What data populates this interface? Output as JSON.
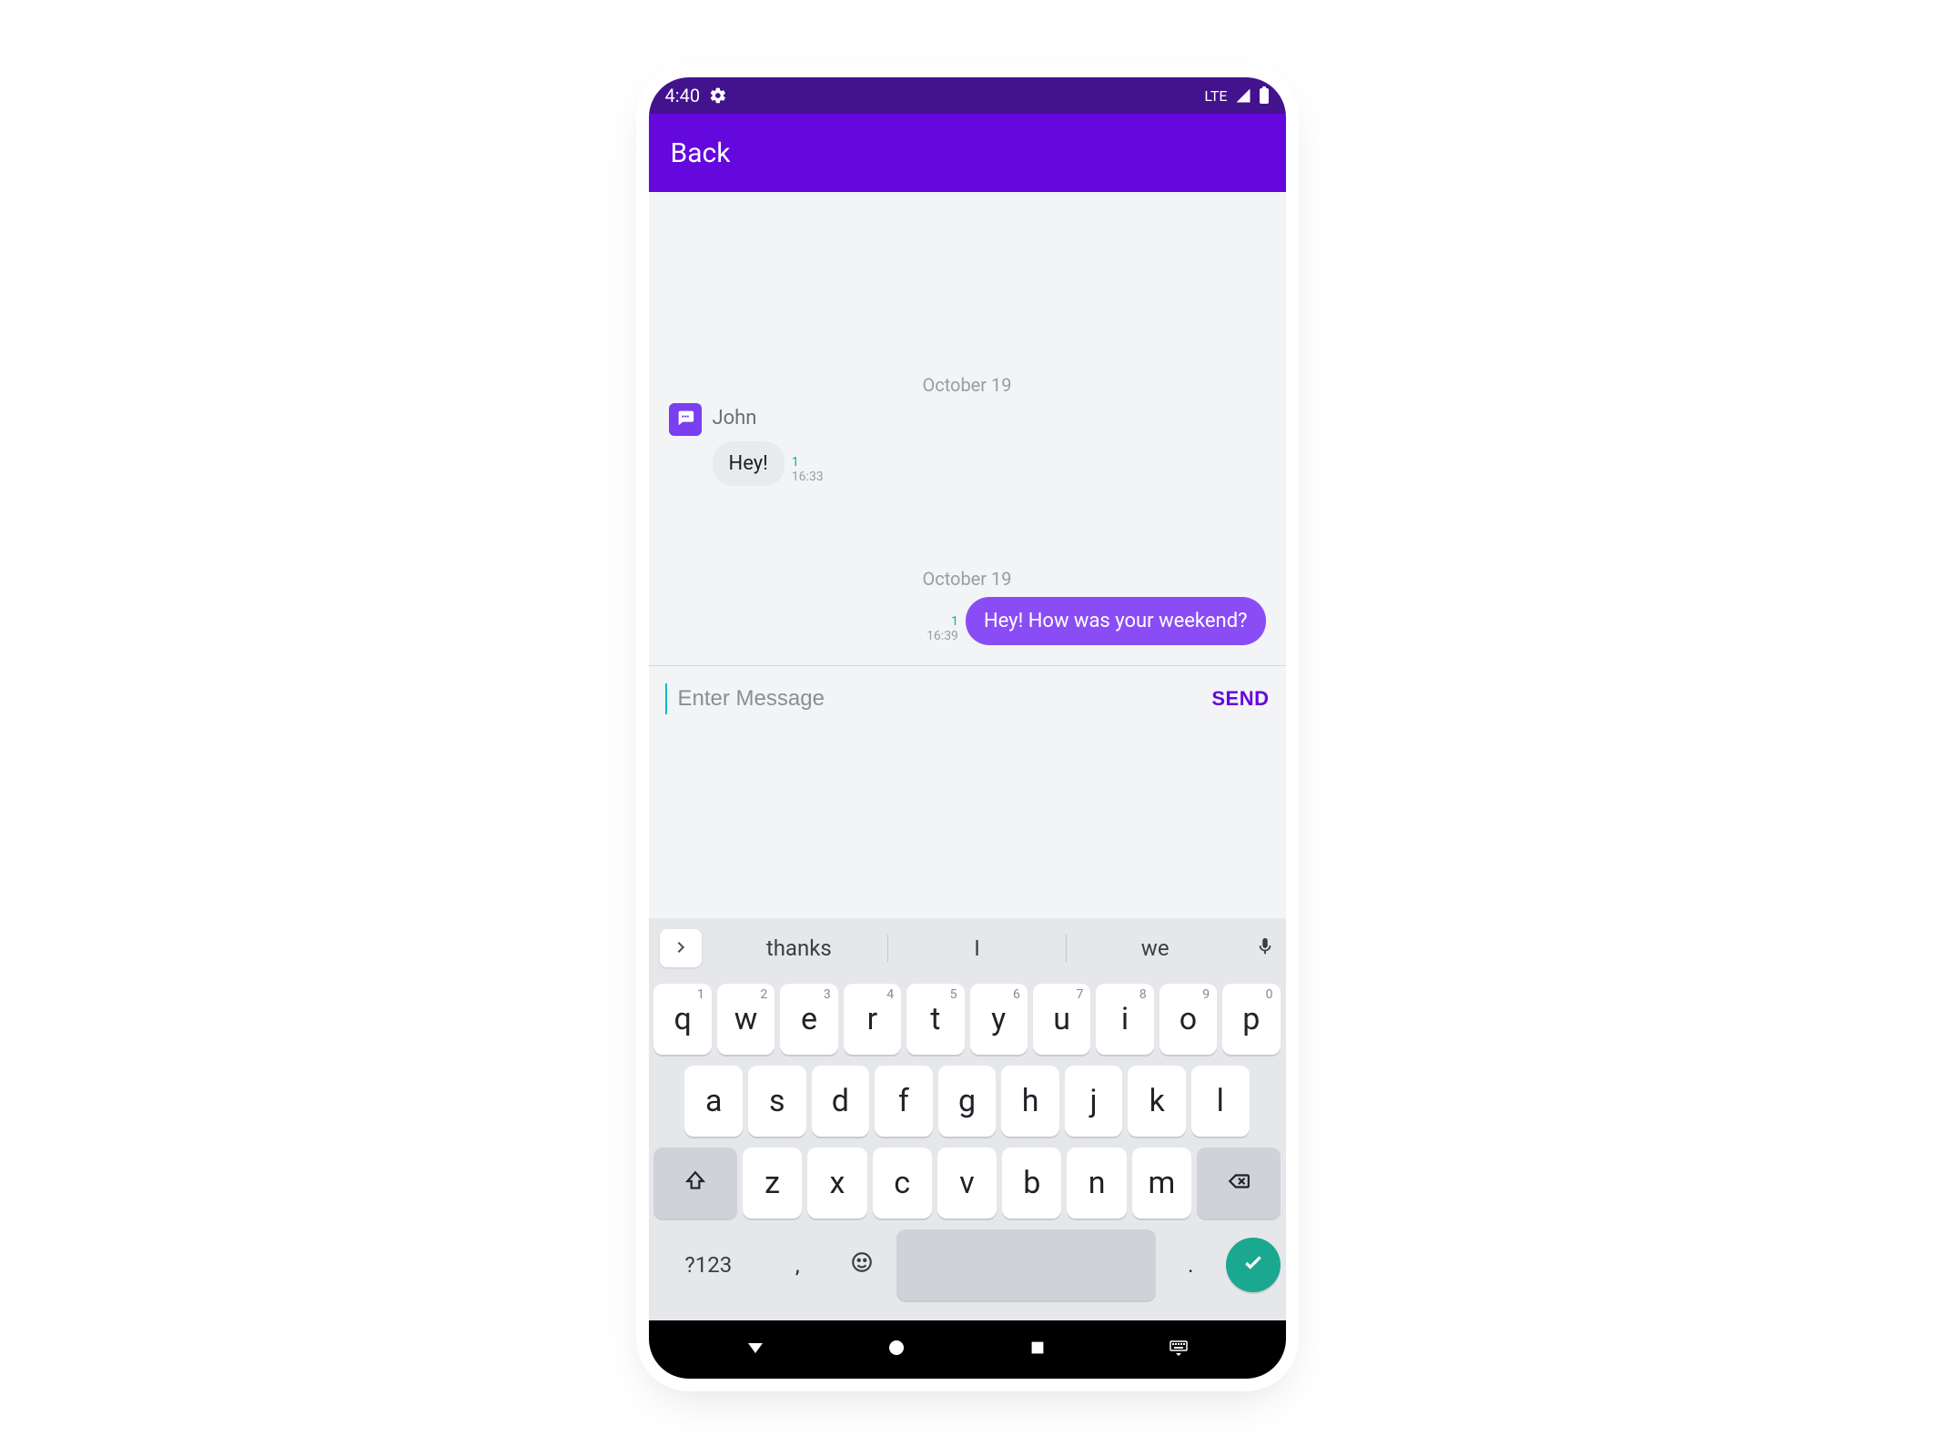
{
  "status": {
    "time": "4:40",
    "network": "LTE"
  },
  "appbar": {
    "back": "Back"
  },
  "chat": {
    "separators": {
      "d1": "October 19",
      "d2": "October 19"
    },
    "incoming": {
      "sender": "John",
      "text": "Hey!",
      "count": "1",
      "time": "16:33"
    },
    "outgoing": {
      "text": "Hey! How was your weekend?",
      "count": "1",
      "time": "16:39"
    }
  },
  "composer": {
    "placeholder": "Enter Message",
    "send": "SEND"
  },
  "keyboard": {
    "suggestions": [
      "thanks",
      "I",
      "we"
    ],
    "row1": [
      "q",
      "w",
      "e",
      "r",
      "t",
      "y",
      "u",
      "i",
      "o",
      "p"
    ],
    "row1nums": [
      "1",
      "2",
      "3",
      "4",
      "5",
      "6",
      "7",
      "8",
      "9",
      "0"
    ],
    "row2": [
      "a",
      "s",
      "d",
      "f",
      "g",
      "h",
      "j",
      "k",
      "l"
    ],
    "row3": [
      "z",
      "x",
      "c",
      "v",
      "b",
      "n",
      "m"
    ],
    "symKey": "?123",
    "comma": ",",
    "period": "."
  }
}
